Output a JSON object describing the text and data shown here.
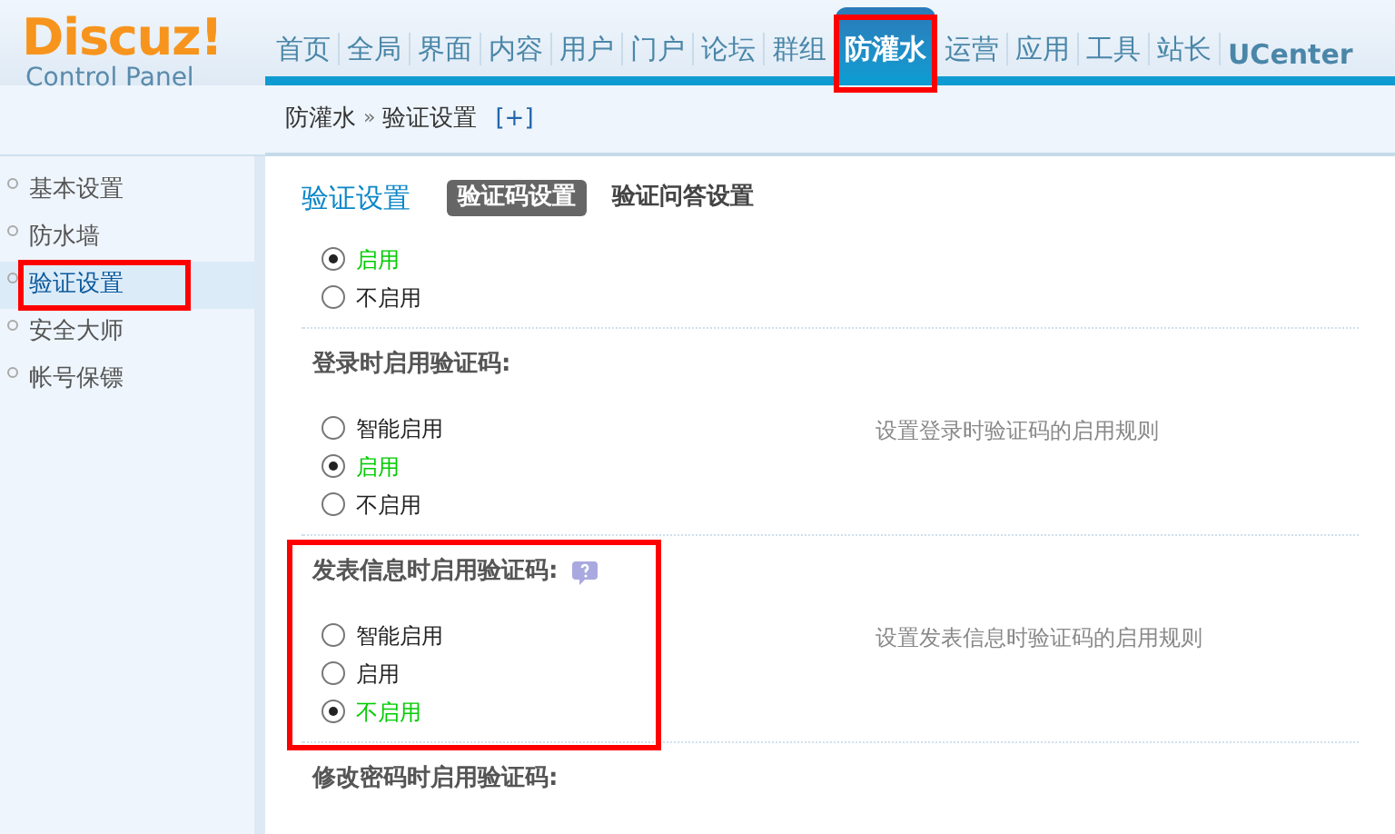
{
  "logo": {
    "title": "Discuz!",
    "subtitle": "Control Panel"
  },
  "nav": [
    {
      "label": "首页",
      "selected": false,
      "highlighted": false
    },
    {
      "label": "全局",
      "selected": false,
      "highlighted": false
    },
    {
      "label": "界面",
      "selected": false,
      "highlighted": false
    },
    {
      "label": "内容",
      "selected": false,
      "highlighted": false
    },
    {
      "label": "用户",
      "selected": false,
      "highlighted": false
    },
    {
      "label": "门户",
      "selected": false,
      "highlighted": false
    },
    {
      "label": "论坛",
      "selected": false,
      "highlighted": false
    },
    {
      "label": "群组",
      "selected": false,
      "highlighted": false
    },
    {
      "label": "防灌水",
      "selected": true,
      "highlighted": true
    },
    {
      "label": "运营",
      "selected": false,
      "highlighted": false
    },
    {
      "label": "应用",
      "selected": false,
      "highlighted": false
    },
    {
      "label": "工具",
      "selected": false,
      "highlighted": false
    },
    {
      "label": "站长",
      "selected": false,
      "highlighted": false
    },
    {
      "label": "UCenter",
      "selected": false,
      "highlighted": false
    }
  ],
  "breadcrumb": {
    "parent": "防灌水",
    "separator": "»",
    "current": "验证设置",
    "toggle": "[+]"
  },
  "sidebar": {
    "items": [
      {
        "label": "基本设置",
        "selected": false,
        "highlighted": false
      },
      {
        "label": "防水墙",
        "selected": false,
        "highlighted": false
      },
      {
        "label": "验证设置",
        "selected": true,
        "highlighted": true
      },
      {
        "label": "安全大师",
        "selected": false,
        "highlighted": false
      },
      {
        "label": "帐号保镖",
        "selected": false,
        "highlighted": false
      }
    ]
  },
  "page_title": "验证设置",
  "tabs": [
    {
      "label": "验证码设置",
      "selected": true
    },
    {
      "label": "验证问答设置",
      "selected": false
    }
  ],
  "sections": [
    {
      "highlighted": false,
      "options": [
        {
          "label": "启用",
          "selected": true
        },
        {
          "label": "不启用",
          "selected": false
        }
      ]
    },
    {
      "title": "登录时启用验证码:",
      "highlighted": false,
      "description": "设置登录时验证码的启用规则",
      "options": [
        {
          "label": "智能启用",
          "selected": false
        },
        {
          "label": "启用",
          "selected": true
        },
        {
          "label": "不启用",
          "selected": false
        }
      ]
    },
    {
      "title": "发表信息时启用验证码:",
      "help": true,
      "highlighted": true,
      "description": "设置发表信息时验证码的启用规则",
      "options": [
        {
          "label": "智能启用",
          "selected": false
        },
        {
          "label": "启用",
          "selected": false
        },
        {
          "label": "不启用",
          "selected": true
        }
      ]
    },
    {
      "title": "修改密码时启用验证码:",
      "highlighted": false
    }
  ]
}
